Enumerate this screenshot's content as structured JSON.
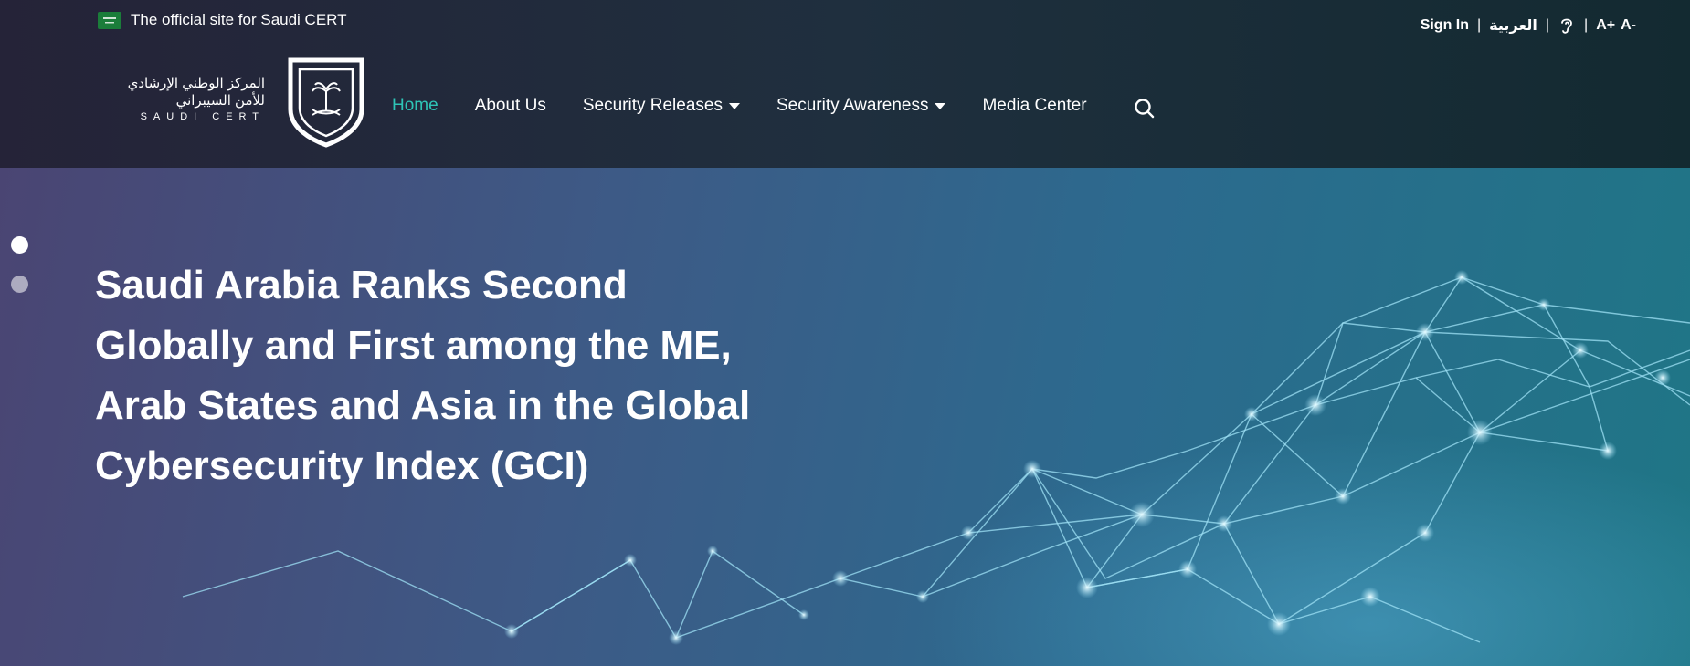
{
  "topbar": {
    "official_text": "The official site for Saudi CERT",
    "sign_in": "Sign In",
    "separator": "|",
    "language": "العربية",
    "font_increase": "A+",
    "font_decrease": "A-"
  },
  "logo": {
    "arabic_line1": "المركز الوطني الإرشادي",
    "arabic_line2": "للأمن السيبراني",
    "english": "SAUDI CERT"
  },
  "nav": {
    "items": [
      {
        "label": "Home",
        "active": true
      },
      {
        "label": "About Us"
      },
      {
        "label": "Security Releases",
        "dropdown": true
      },
      {
        "label": "Security Awareness",
        "dropdown": true
      },
      {
        "label": "Media Center"
      }
    ]
  },
  "hero": {
    "title": "Saudi Arabia Ranks Second Globally and First among the ME, Arab States and Asia in the Global Cybersecurity Index (GCI)",
    "slide_count": 2,
    "active_slide": 1
  },
  "icons": {
    "flag": "saudi-flag-icon",
    "accessibility": "ear-icon",
    "search": "search-icon",
    "emblem": "palm-swords-icon"
  },
  "colors": {
    "accent": "#2ec4b6",
    "header_bg": "#1f2f3e",
    "text": "#ffffff"
  }
}
